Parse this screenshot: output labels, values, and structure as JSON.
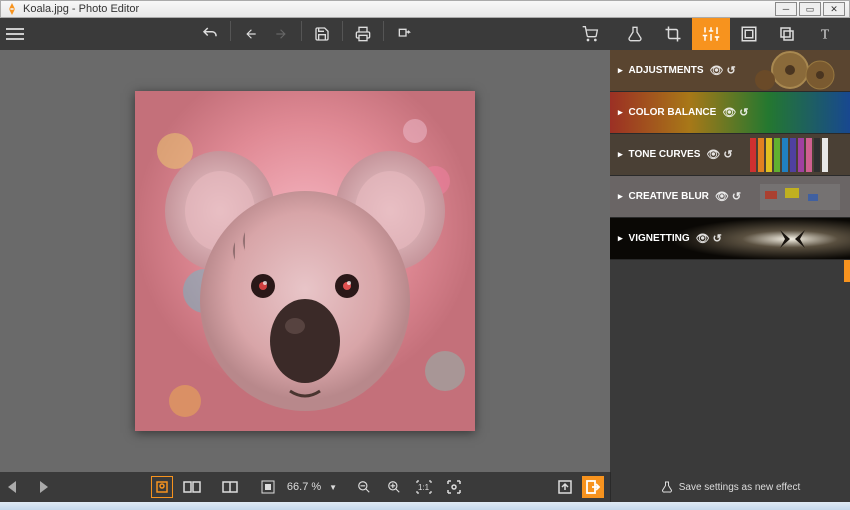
{
  "title": "Koala.jpg - Photo Editor",
  "toolbar": {
    "undo": "Undo",
    "back": "Back",
    "forward": "Forward",
    "save": "Save",
    "print": "Print",
    "export": "Export",
    "cart": "Shop"
  },
  "modes": {
    "flask": "Effects",
    "crop": "Crop",
    "adjust": "Adjustments",
    "frame": "Frame",
    "layers": "Layers",
    "text": "Text"
  },
  "sidepanel": {
    "items": [
      {
        "label": "ADJUSTMENTS"
      },
      {
        "label": "COLOR BALANCE"
      },
      {
        "label": "TONE CURVES"
      },
      {
        "label": "CREATIVE BLUR"
      },
      {
        "label": "VIGNETTING"
      }
    ]
  },
  "bottombar": {
    "zoom": "66.7 %",
    "save_effect": "Save settings as new effect"
  },
  "colors": {
    "accent": "#f7931e",
    "panel": "#3a3a3a",
    "canvas": "#6a6a6a"
  }
}
